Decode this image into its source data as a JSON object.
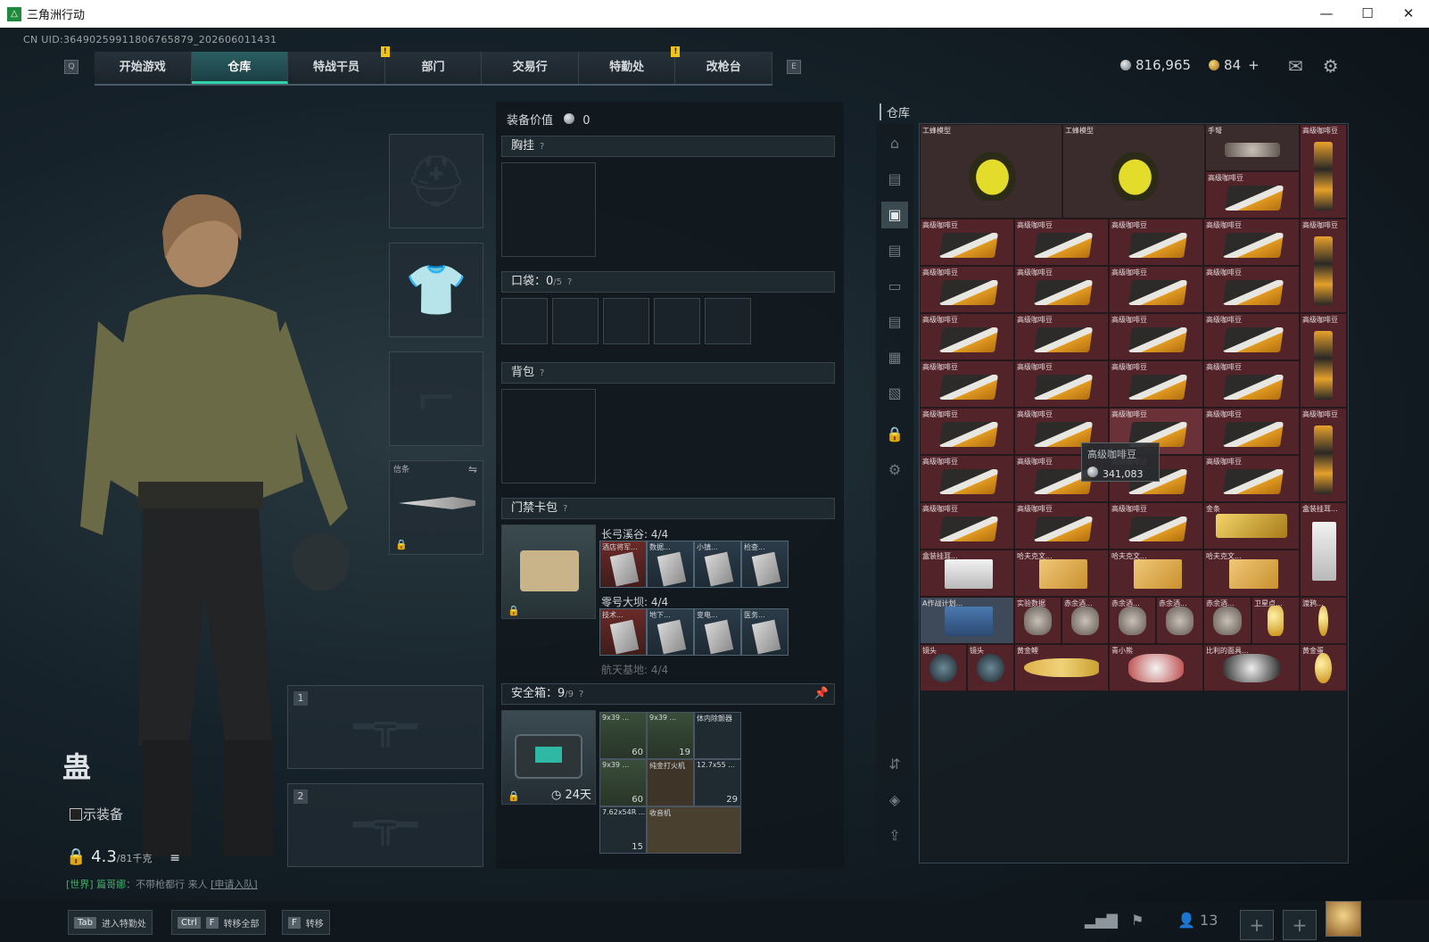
{
  "window": {
    "title": "三角洲行动",
    "logo": "△",
    "controls": [
      "—",
      "☐",
      "✕"
    ]
  },
  "uid": "CN UID:3649025991180676587​9_202606011431",
  "nav": {
    "left_key": "Q",
    "right_key": "E",
    "tabs": [
      "开始游戏",
      "仓库",
      "特战干员",
      "部门",
      "交易行",
      "特勤处",
      "改枪台"
    ],
    "active": "仓库"
  },
  "currency": {
    "silver": "816,965",
    "gold": "84",
    "plus": "+"
  },
  "character": {
    "name": "蛊",
    "show_equip": "显示装备",
    "weight": "4.3",
    "weight_max": "/81千克"
  },
  "chat": {
    "channel": "[世界]",
    "user": "篇哥娜",
    "msg": "：不带枪都行 来人",
    "link": "[申请入队]"
  },
  "equip": {
    "melee_label": "信条",
    "slot1": "1",
    "slot2": "2"
  },
  "mid": {
    "value_label": "装备价值",
    "value": "0",
    "chest": "胸挂",
    "pocket": "口袋：",
    "pocket_count": "0",
    "pocket_max": "/5",
    "backpack": "背包",
    "keycard": "门禁卡包",
    "q": "?",
    "safe": "安全箱：",
    "safe_count": "9",
    "safe_max": "/9",
    "safe_timer": "24天",
    "maps": [
      {
        "title": "长弓溪谷: 4/4",
        "cards": [
          "酒店将军...",
          "数据...",
          "小镇...",
          "检查..."
        ]
      },
      {
        "title": "零号大坝: 4/4",
        "cards": [
          "技术...",
          "地下...",
          "变电...",
          "医务..."
        ]
      },
      {
        "title": "航天基地: 4/4",
        "cards": []
      }
    ],
    "safe_items": [
      {
        "name": "9x39 ...",
        "count": "60"
      },
      {
        "name": "9x39 ...",
        "count": "19"
      },
      {
        "name": "体内除颤器",
        "count": ""
      },
      {
        "name": "9x39 ...",
        "count": "60"
      },
      {
        "name": "纯金打火机",
        "count": ""
      },
      {
        "name": "12.7x55 ...",
        "count": "29"
      },
      {
        "name": "7.62x54R ...",
        "count": "15"
      },
      {
        "name": "收音机",
        "count": ""
      }
    ]
  },
  "warehouse": {
    "title": "仓库",
    "tooltip": {
      "name": "高级咖啡豆",
      "value": "341,083"
    },
    "items": {
      "bee": "工蜂模型",
      "crossbow": "手弩",
      "coffee": "高级咖啡豆",
      "goldbar": "金条",
      "earphone": "盒装挂耳...",
      "boxed": "盒装挂耳...",
      "doc": "哈夫克文...",
      "combat": "A作战计划...",
      "lab": "实验数据",
      "bowl": "赤余酒...",
      "ring": "卫星点...",
      "key": "渡鸦...",
      "lens": "镜头",
      "fish": "黄金鲤",
      "astro": "青小熊",
      "doll": "比利的面具...",
      "egg": "黄金蛋"
    }
  },
  "bottom": {
    "hint1_key": "Tab",
    "hint1": "进入特勤处",
    "hint2_key": "Ctrl",
    "hint2_key2": "F",
    "hint2": "转移全部",
    "hint3_key": "F",
    "hint3": "转移",
    "players": "13"
  }
}
